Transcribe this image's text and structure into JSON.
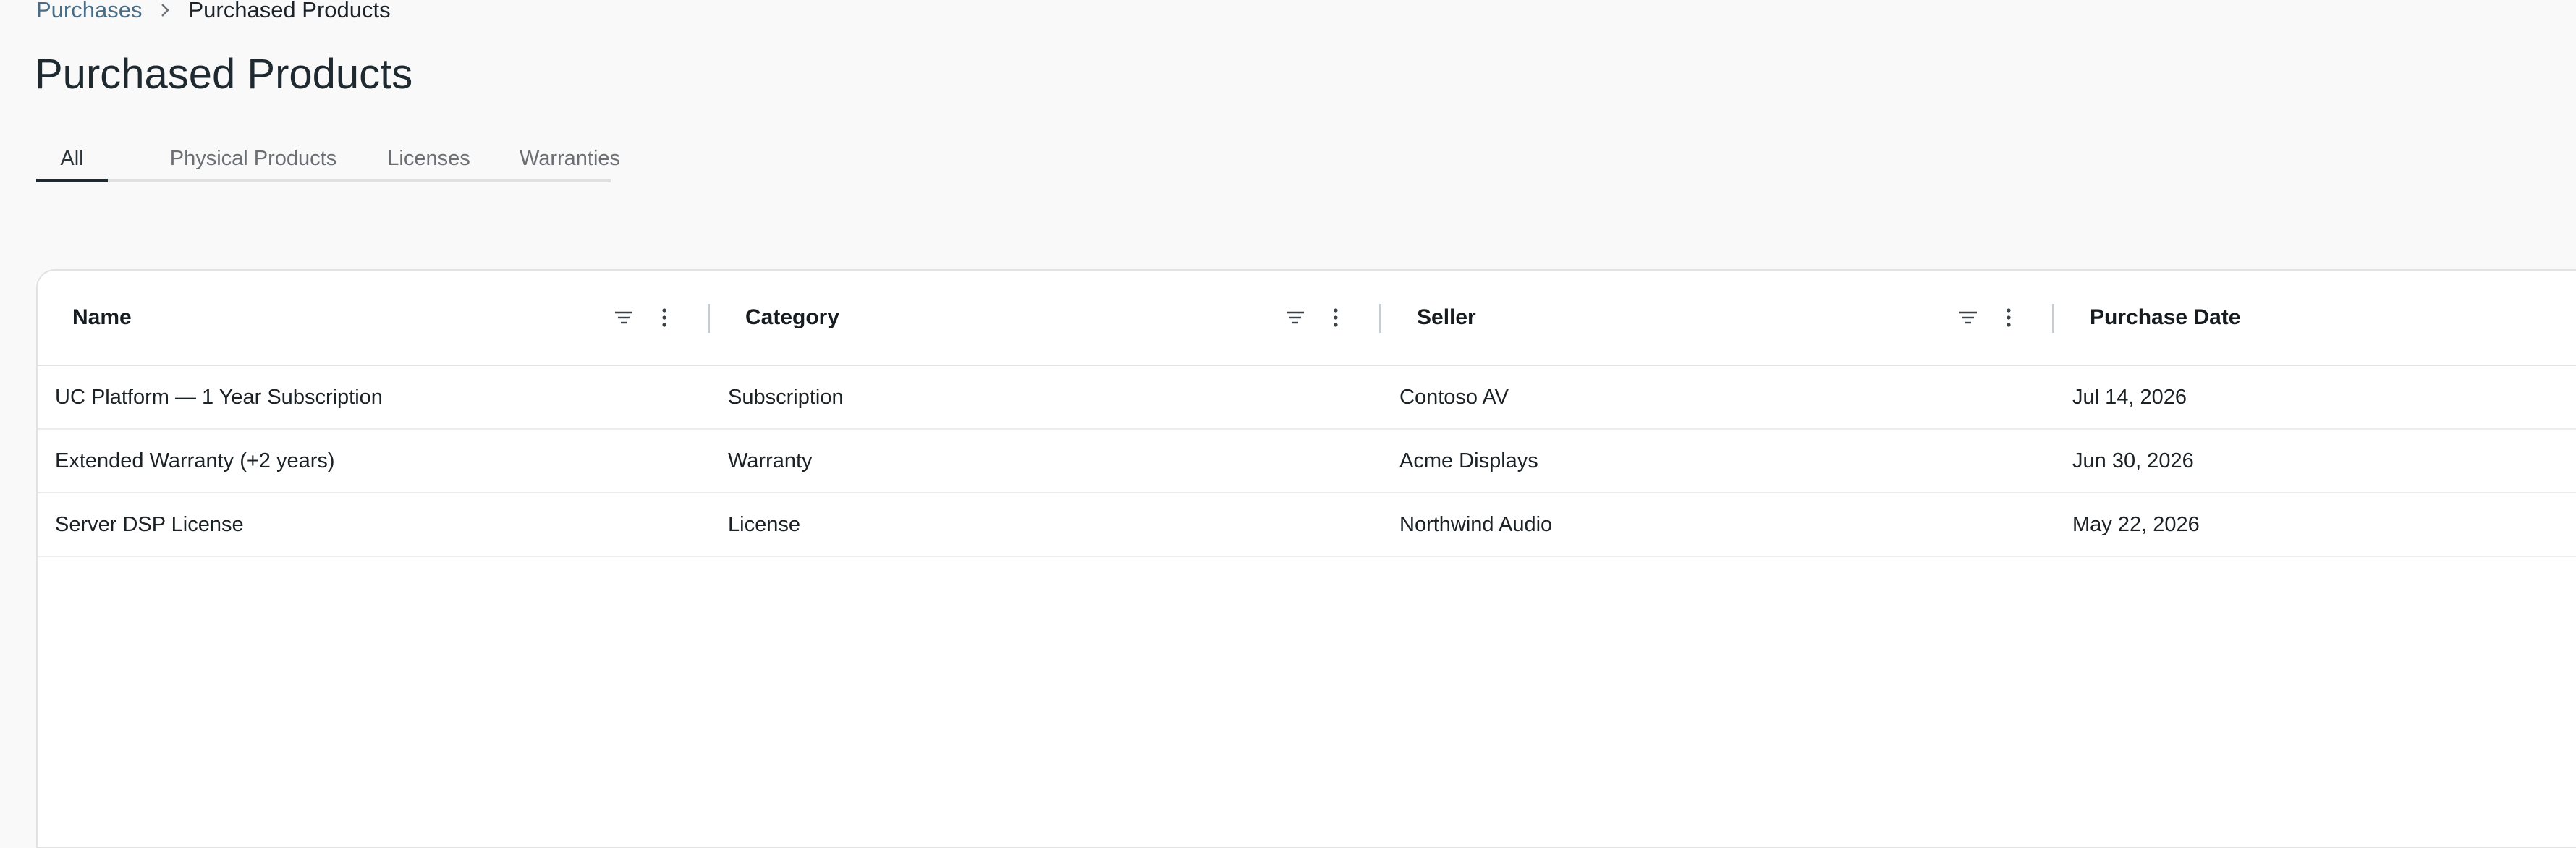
{
  "breadcrumb": {
    "parent": "Purchases",
    "current": "Purchased Products"
  },
  "page": {
    "title": "Purchased Products"
  },
  "tabs": [
    {
      "label": "All",
      "active": true
    },
    {
      "label": "Physical Products",
      "active": false
    },
    {
      "label": "Licenses",
      "active": false
    },
    {
      "label": "Warranties",
      "active": false
    }
  ],
  "table": {
    "columns": [
      "Name",
      "Category",
      "Seller",
      "Purchase Date"
    ],
    "rows": [
      [
        "UC Platform — 1 Year Subscription",
        "Subscription",
        "Contoso AV",
        "Jul 14, 2026"
      ],
      [
        "Extended Warranty (+2 years)",
        "Warranty",
        "Acme Displays",
        "Jun 30, 2026"
      ],
      [
        "Server DSP License",
        "License",
        "Northwind Audio",
        "May 22, 2026"
      ]
    ]
  },
  "icons": {
    "breadcrumb_separator": "chevron-right-icon",
    "column_filter": "filter-icon",
    "column_menu": "more-vertical-icon"
  },
  "colors": {
    "breadcrumb_link": "#4a6d86",
    "tab_indicator": "#1f2a30",
    "page_background": "#f9f9f9"
  }
}
